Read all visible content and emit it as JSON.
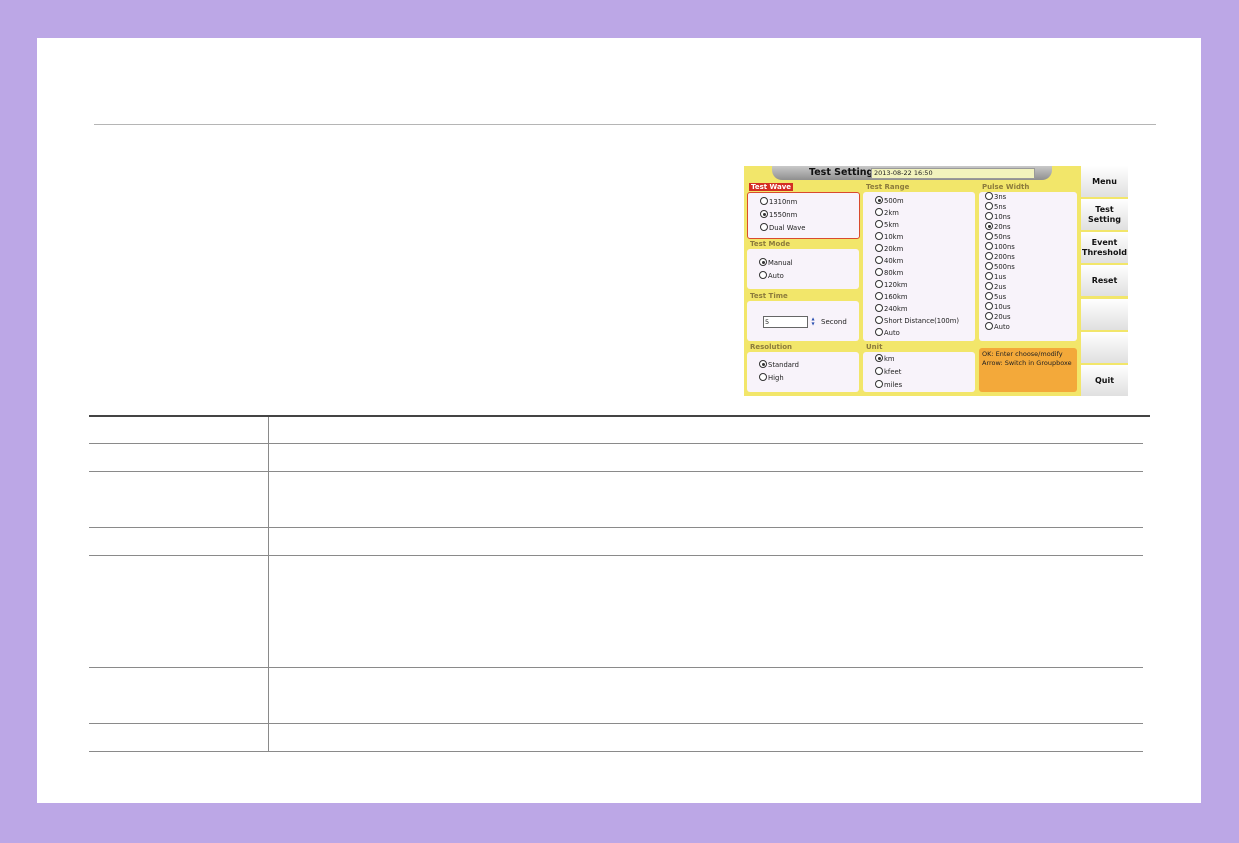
{
  "screen": {
    "title": "Test Setting",
    "datetime": "2013-08-22 16:50",
    "test_wave": {
      "title": "Test Wave",
      "options": [
        {
          "label": "1310nm",
          "selected": false
        },
        {
          "label": "1550nm",
          "selected": true
        },
        {
          "label": "Dual Wave",
          "selected": false
        }
      ]
    },
    "test_mode": {
      "title": "Test Mode",
      "options": [
        {
          "label": "Manual",
          "selected": true
        },
        {
          "label": "Auto",
          "selected": false
        }
      ]
    },
    "test_time": {
      "title": "Test Time",
      "value": "5",
      "unit": "Second"
    },
    "resolution": {
      "title": "Resolution",
      "options": [
        {
          "label": "Standard",
          "selected": true
        },
        {
          "label": "High",
          "selected": false
        }
      ]
    },
    "test_range": {
      "title": "Test Range",
      "options": [
        {
          "label": "500m",
          "selected": true
        },
        {
          "label": "2km",
          "selected": false
        },
        {
          "label": "5km",
          "selected": false
        },
        {
          "label": "10km",
          "selected": false
        },
        {
          "label": "20km",
          "selected": false
        },
        {
          "label": "40km",
          "selected": false
        },
        {
          "label": "80km",
          "selected": false
        },
        {
          "label": "120km",
          "selected": false
        },
        {
          "label": "160km",
          "selected": false
        },
        {
          "label": "240km",
          "selected": false
        },
        {
          "label": "Short Distance(100m)",
          "selected": false
        },
        {
          "label": "Auto",
          "selected": false
        }
      ]
    },
    "unit": {
      "title": "Unit",
      "options": [
        {
          "label": "km",
          "selected": true
        },
        {
          "label": "kfeet",
          "selected": false
        },
        {
          "label": "miles",
          "selected": false
        }
      ]
    },
    "pulse_width": {
      "title": "Pulse Width",
      "options": [
        {
          "label": "3ns",
          "selected": false
        },
        {
          "label": "5ns",
          "selected": false
        },
        {
          "label": "10ns",
          "selected": false
        },
        {
          "label": "20ns",
          "selected": true
        },
        {
          "label": "50ns",
          "selected": false
        },
        {
          "label": "100ns",
          "selected": false
        },
        {
          "label": "200ns",
          "selected": false
        },
        {
          "label": "500ns",
          "selected": false
        },
        {
          "label": "1us",
          "selected": false
        },
        {
          "label": "2us",
          "selected": false
        },
        {
          "label": "5us",
          "selected": false
        },
        {
          "label": "10us",
          "selected": false
        },
        {
          "label": "20us",
          "selected": false
        },
        {
          "label": "Auto",
          "selected": false
        }
      ]
    },
    "hint": {
      "line1": "OK: Enter choose/modify",
      "line2": "Arrow: Switch in Groupboxe"
    },
    "side_buttons": [
      "Menu",
      "Test\nSetting",
      "Event\nThreshold",
      "Reset",
      "",
      "",
      "Quit"
    ]
  }
}
